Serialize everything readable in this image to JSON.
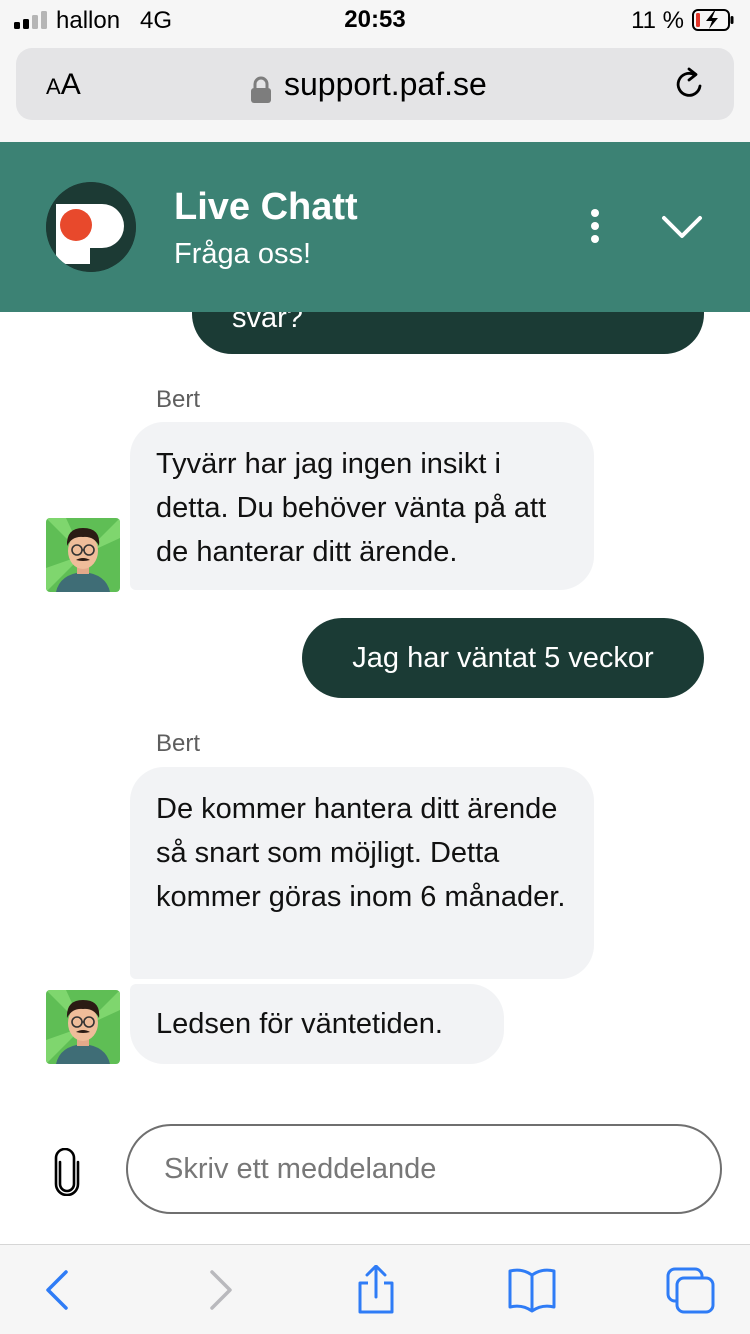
{
  "status_bar": {
    "carrier": "hallon",
    "network": "4G",
    "time": "20:53",
    "battery_percent": "11 %",
    "signal_bars": 2,
    "battery_level": 0.11
  },
  "browser": {
    "text_size_label_small": "A",
    "text_size_label_large": "A",
    "url": "support.paf.se"
  },
  "chat": {
    "title": "Live Chatt",
    "subtitle": "Fråga oss!",
    "brand_color": "#3c8274",
    "outgoing_color": "#1b3b35"
  },
  "messages": {
    "clipped_outgoing": "svar?",
    "group_1": {
      "sender": "Bert",
      "text": "Tyvärr har jag ingen insikt i detta. Du behöver vänta på att de hanterar ditt ärende."
    },
    "outgoing_1": "Jag har väntat 5 veckor",
    "group_2": {
      "sender": "Bert",
      "text_1": "De kommer hantera ditt ärende så snart som möjligt. Detta kommer göras inom 6 månader.",
      "text_2": "Ledsen för väntetiden."
    }
  },
  "composer": {
    "placeholder": "Skriv ett meddelande"
  },
  "icons": {
    "back": "chevron-left-icon",
    "forward": "chevron-right-icon",
    "share": "share-icon",
    "bookmarks": "book-icon",
    "tabs": "tabs-icon",
    "attach": "paperclip-icon"
  }
}
